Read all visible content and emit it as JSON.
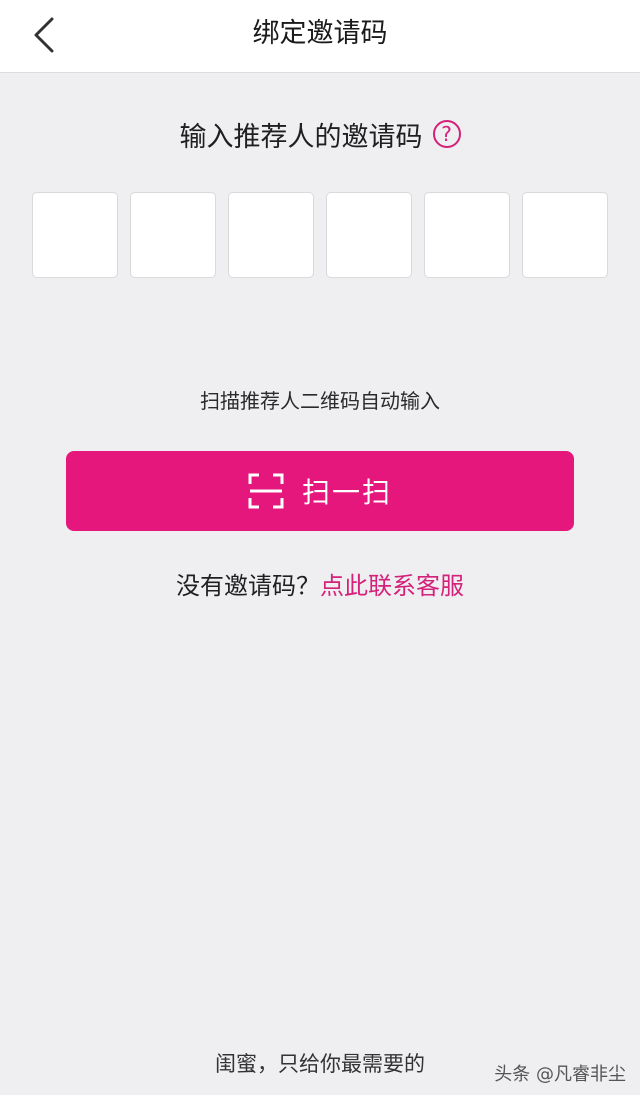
{
  "navbar": {
    "title": "绑定邀请码",
    "back_icon": "chevron-left-icon"
  },
  "prompt": {
    "text": "输入推荐人的邀请码",
    "help_icon": "question-circle-icon",
    "help_glyph": "?"
  },
  "code_inputs": [
    "",
    "",
    "",
    "",
    "",
    ""
  ],
  "scan": {
    "hint": "扫描推荐人二维码自动输入",
    "button_label": "扫一扫",
    "button_icon": "scan-frame-icon"
  },
  "no_code": {
    "text": "没有邀请码？",
    "link": "点此联系客服"
  },
  "footer": {
    "slogan": "闺蜜，只给你最需要的",
    "watermark": "头条 @凡睿非尘"
  },
  "colors": {
    "accent": "#e5177c",
    "link": "#d4217a",
    "background": "#efeef1"
  }
}
